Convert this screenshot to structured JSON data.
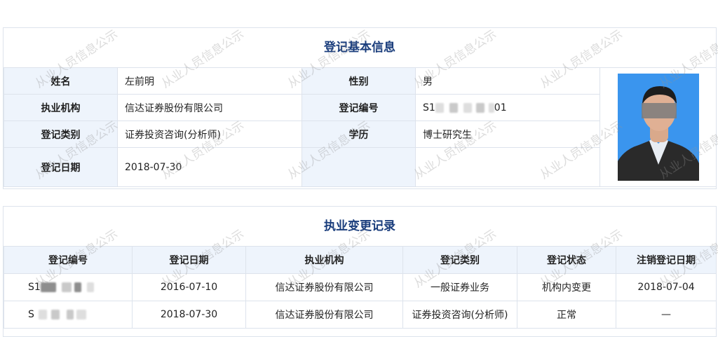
{
  "basic": {
    "title": "登记基本信息",
    "name_label": "姓名",
    "name_value": "左前明",
    "gender_label": "性别",
    "gender_value": "男",
    "org_label": "执业机构",
    "org_value": "信达证券股份有限公司",
    "regno_label": "登记编号",
    "regno_prefix": "S1",
    "regno_suffix": "01",
    "category_label": "登记类别",
    "category_value": "证券投资咨询(分析师)",
    "edu_label": "学历",
    "edu_value": "博士研究生",
    "date_label": "登记日期",
    "date_value": "2018-07-30"
  },
  "history": {
    "title": "执业变更记录",
    "columns": [
      "登记编号",
      "登记日期",
      "执业机构",
      "登记类别",
      "登记状态",
      "注销登记日期"
    ],
    "rows": [
      {
        "id_prefix": "S1",
        "date": "2016-07-10",
        "org": "信达证券股份有限公司",
        "category": "一般证券业务",
        "status": "机构内变更",
        "cancel_date": "2018-07-04"
      },
      {
        "id_prefix": "S",
        "date": "2018-07-30",
        "org": "信达证券股份有限公司",
        "category": "证券投资咨询(分析师)",
        "status": "正常",
        "cancel_date": "—"
      }
    ]
  },
  "watermark": "从业人员信息公示"
}
